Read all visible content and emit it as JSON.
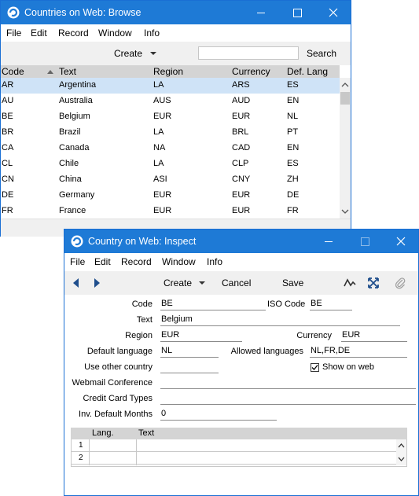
{
  "browse_window": {
    "title": "Countries on Web: Browse",
    "menu": [
      "File",
      "Edit",
      "Record",
      "Window",
      "Info"
    ],
    "create_label": "Create",
    "search_placeholder": "",
    "search_label": "Search",
    "columns": [
      "Code",
      "Text",
      "Region",
      "Currency",
      "Def. Lang"
    ],
    "rows": [
      [
        "AR",
        "Argentina",
        "LA",
        "ARS",
        "ES"
      ],
      [
        "AU",
        "Australia",
        "AUS",
        "AUD",
        "EN"
      ],
      [
        "BE",
        "Belgium",
        "EUR",
        "EUR",
        "NL"
      ],
      [
        "BR",
        "Brazil",
        "LA",
        "BRL",
        "PT"
      ],
      [
        "CA",
        "Canada",
        "NA",
        "CAD",
        "EN"
      ],
      [
        "CL",
        "Chile",
        "LA",
        "CLP",
        "ES"
      ],
      [
        "CN",
        "China",
        "ASI",
        "CNY",
        "ZH"
      ],
      [
        "DE",
        "Germany",
        "EUR",
        "EUR",
        "DE"
      ],
      [
        "FR",
        "France",
        "EUR",
        "EUR",
        "FR"
      ]
    ]
  },
  "inspect_window": {
    "title": "Country on Web: Inspect",
    "menu": [
      "File",
      "Edit",
      "Record",
      "Window",
      "Info"
    ],
    "toolbar": {
      "create_label": "Create",
      "cancel_label": "Cancel",
      "save_label": "Save"
    },
    "form": {
      "code_label": "Code",
      "code_value": "BE",
      "iso_label": "ISO Code",
      "iso_value": "BE",
      "text_label": "Text",
      "text_value": "Belgium",
      "region_label": "Region",
      "region_value": "EUR",
      "currency_label": "Currency",
      "currency_value": "EUR",
      "deflang_label": "Default language",
      "deflang_value": "NL",
      "allowed_label": "Allowed languages",
      "allowed_value": "NL,FR,DE",
      "useother_label": "Use other country",
      "useother_value": "",
      "showonweb_label": "Show on web",
      "showonweb_checked": true,
      "webmail_label": "Webmail Conference",
      "webmail_value": "",
      "credit_label": "Credit Card Types",
      "credit_value": "",
      "invmonths_label": "Inv. Default Months",
      "invmonths_value": "0"
    },
    "matrix": {
      "columns": [
        "Lang.",
        "Text"
      ],
      "rows": [
        {
          "num": "1",
          "lang": "",
          "text": ""
        },
        {
          "num": "2",
          "lang": "",
          "text": ""
        }
      ]
    }
  }
}
